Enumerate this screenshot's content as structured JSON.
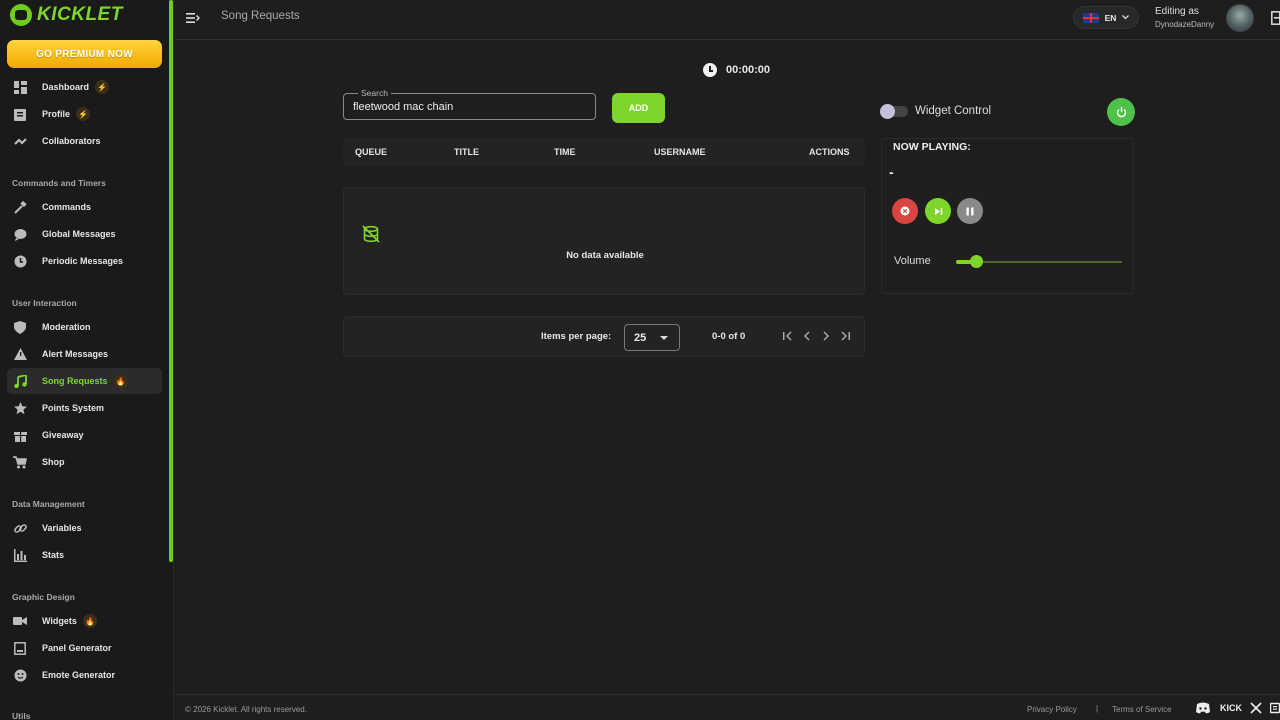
{
  "brand": {
    "name": "KICKLET"
  },
  "sidebar": {
    "premium_label": "GO PREMIUM NOW",
    "items": [
      {
        "label": "Dashboard",
        "icon": "dashboard-icon",
        "badge": "⚡"
      },
      {
        "label": "Profile",
        "icon": "profile-icon",
        "badge": "⚡"
      },
      {
        "label": "Collaborators",
        "icon": "collaborators-icon"
      },
      {
        "label": "Commands",
        "icon": "hammer-icon"
      },
      {
        "label": "Global Messages",
        "icon": "chat-icon"
      },
      {
        "label": "Periodic Messages",
        "icon": "clock-icon"
      },
      {
        "label": "Moderation",
        "icon": "shield-icon"
      },
      {
        "label": "Alert Messages",
        "icon": "warning-icon"
      },
      {
        "label": "Song Requests",
        "icon": "music-icon",
        "badge": "🔥",
        "active": true
      },
      {
        "label": "Points System",
        "icon": "star-icon"
      },
      {
        "label": "Giveaway",
        "icon": "gift-icon"
      },
      {
        "label": "Shop",
        "icon": "cart-icon"
      },
      {
        "label": "Variables",
        "icon": "link-icon"
      },
      {
        "label": "Stats",
        "icon": "bar-chart-icon"
      },
      {
        "label": "Widgets",
        "icon": "camera-icon",
        "badge": "🔥"
      },
      {
        "label": "Panel Generator",
        "icon": "panel-icon"
      },
      {
        "label": "Emote Generator",
        "icon": "emote-icon"
      }
    ],
    "sections": {
      "commands_timers": "Commands and Timers",
      "user_interaction": "User Interaction",
      "data_management": "Data Management",
      "graphic_design": "Graphic Design",
      "utils": "Utils"
    }
  },
  "topbar": {
    "page_title": "Song Requests",
    "language": "EN",
    "editing_label": "Editing as",
    "editing_user": "DynodazeDanny"
  },
  "timer": {
    "value": "00:00:00"
  },
  "search": {
    "label": "Search",
    "value": "fleetwood mac chain"
  },
  "add_button": "ADD",
  "table": {
    "columns": [
      "QUEUE",
      "TITLE",
      "TIME",
      "USERNAME",
      "ACTIONS"
    ],
    "empty_text": "No data available"
  },
  "pagination": {
    "items_per_page_label": "Items per page:",
    "items_per_page": "25",
    "range": "0-0 of 0"
  },
  "widget": {
    "control_label": "Widget Control",
    "now_playing_label": "NOW PLAYING:",
    "now_playing_track": "-",
    "volume_label": "Volume",
    "volume_level": 0.12
  },
  "footer": {
    "copyright": "© 2026 Kicklet. All rights reserved.",
    "privacy": "Privacy Policy",
    "separator": "|",
    "terms": "Terms of Service",
    "kick_label": "KICK"
  },
  "colors": {
    "accent": "#7fd62a",
    "premium": "#f0a900",
    "stop": "#d9453f",
    "background": "#1e1e1e"
  }
}
